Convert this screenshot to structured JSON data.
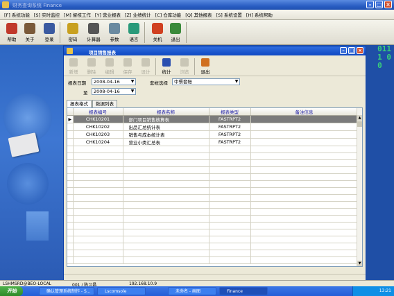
{
  "app": {
    "title": "财务查询系统 Finance"
  },
  "menu": [
    "[F] 系统功能",
    "[S] 实时监控",
    "[M] 督核工作",
    "[Y] 营业报表",
    "[Z] 业绩统计",
    "[C] 仓库功能",
    "[Q] 其他报表",
    "[S] 系统设置",
    "[H] 系统帮助"
  ],
  "toolbar": [
    {
      "label": "帮助",
      "icon": "help-icon",
      "color": "#c0392b"
    },
    {
      "label": "关于",
      "icon": "about-icon",
      "color": "#7a5a3a"
    },
    {
      "label": "登录",
      "icon": "login-icon",
      "color": "#3a5aa0"
    },
    {
      "label": "密码",
      "icon": "key-icon",
      "color": "#c8a020"
    },
    {
      "label": "计算器",
      "icon": "calculator-icon",
      "color": "#555555"
    },
    {
      "label": "参数",
      "icon": "gear-icon",
      "color": "#6a8aa0"
    },
    {
      "label": "语言",
      "icon": "globe-icon",
      "color": "#2a9a7a"
    },
    {
      "label": "关机",
      "icon": "power-icon",
      "color": "#d04020"
    },
    {
      "label": "退出",
      "icon": "exit-icon",
      "color": "#3a8a3a"
    }
  ],
  "child": {
    "title": "项目销售报表",
    "toolbar": [
      {
        "label": "新增",
        "icon": "new-icon",
        "enabled": false
      },
      {
        "label": "删除",
        "icon": "delete-icon",
        "enabled": false
      },
      {
        "label": "编辑",
        "icon": "edit-icon",
        "enabled": false
      },
      {
        "label": "保存",
        "icon": "save-icon",
        "enabled": false
      },
      {
        "label": "设计",
        "icon": "design-icon",
        "enabled": false
      },
      {
        "label": "统计",
        "icon": "statistics-icon",
        "enabled": true
      },
      {
        "label": "浏览",
        "icon": "browse-icon",
        "enabled": false
      },
      {
        "label": "退出",
        "icon": "exit-icon",
        "enabled": true
      }
    ],
    "form": {
      "date_label": "报表日期",
      "date_from": "2008-04-16",
      "to_label": "至",
      "date_to": "2008-04-16",
      "account_label": "套帐选择",
      "account_value": "中餐套帐"
    },
    "tabs": [
      "报表格式",
      "数据列表"
    ],
    "grid": {
      "columns": [
        "报表编号",
        "报表名称",
        "报表类型",
        "备注信息"
      ],
      "rows": [
        {
          "code": "CHK10201",
          "name": "部门项目销售核算表",
          "type": "FASTRPT2",
          "note": ""
        },
        {
          "code": "CHK10202",
          "name": "出品汇总统计表",
          "type": "FASTRPT2",
          "note": ""
        },
        {
          "code": "CHK10203",
          "name": "销售与成本统计表",
          "type": "FASTRPT2",
          "note": ""
        },
        {
          "code": "CHK10204",
          "name": "营业小类汇总表",
          "type": "FASTRPT2",
          "note": ""
        }
      ]
    }
  },
  "statusbar": {
    "server": "LSHMSRD@BEO-LOCAL",
    "user": "001 / 陈习昌",
    "ip": "192.168.10.9"
  },
  "taskbar": {
    "start": "开始",
    "tasks": [
      "确认管理系统制作 - S...",
      "Lscomsole",
      "未命名 - 画图",
      "Finance"
    ],
    "time": "13:21"
  },
  "decor": {
    "matrix_code": "011\n1 0\n0"
  }
}
